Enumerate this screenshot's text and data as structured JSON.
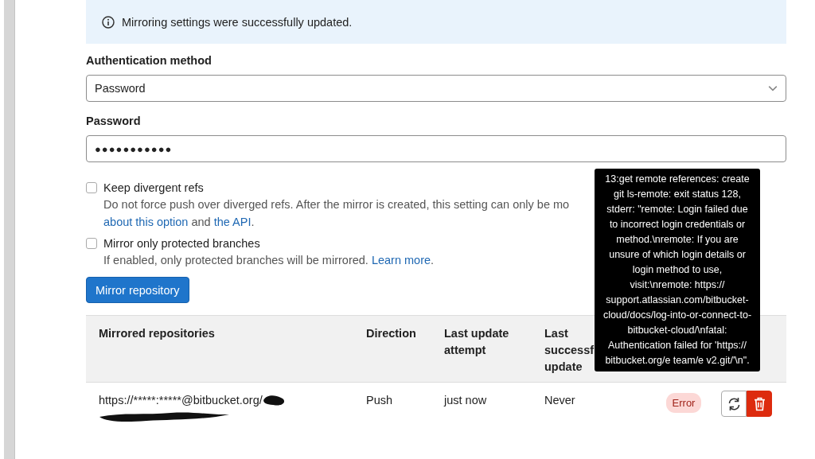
{
  "alert": {
    "message": "Mirroring settings were successfully updated."
  },
  "auth_method": {
    "label": "Authentication method",
    "value": "Password"
  },
  "password": {
    "label": "Password",
    "value": "●●●●●●●●●●●"
  },
  "options": [
    {
      "label": "Keep divergent refs",
      "checked": false,
      "help": [
        {
          "text": "Do not force push over diverged refs. After the mirror is created, this setting can only be mo"
        },
        {
          "text": "about this option",
          "link": true
        },
        {
          "text": " and "
        },
        {
          "text": "the API",
          "link": true
        },
        {
          "text": "."
        }
      ]
    },
    {
      "label": "Mirror only protected branches",
      "checked": false,
      "help": [
        {
          "text": "If enabled, only protected branches will be mirrored. "
        },
        {
          "text": "Learn more",
          "link": true
        },
        {
          "text": "."
        }
      ]
    }
  ],
  "submit_button": "Mirror repository",
  "table": {
    "columns": [
      "Mirrored repositories",
      "Direction",
      "Last update attempt",
      "Last successf update"
    ],
    "rows": [
      {
        "url": "https://*****:*****@bitbucket.org/",
        "direction": "Push",
        "last_attempt": "just now",
        "last_success": "Never",
        "status": "Error"
      }
    ]
  },
  "tooltip": "13:get remote references: create git ls-remote: exit status 128, stderr: \"remote: Login failed due to incorrect login credentials or method.\\nremote: If you are unsure of which login details or login method to use, visit:\\nremote: https://support.atlassian.com/bitbucket-cloud/docs/log-into-or-connect-to-bitbucket-cloud/\\nfatal: Authentication failed for 'https://bitbucket.org/e team/e v2.git/'\\n\"."
}
